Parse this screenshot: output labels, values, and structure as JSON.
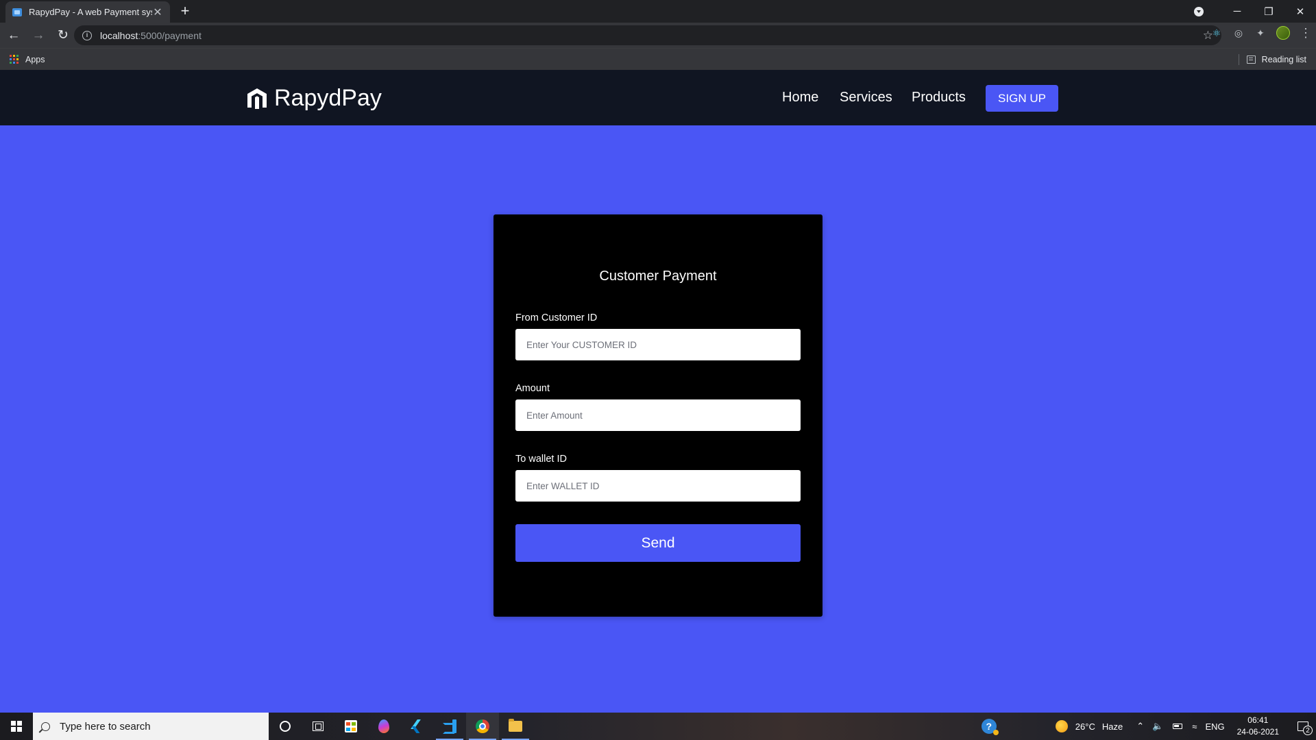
{
  "browser": {
    "tab_title": "RapydPay - A web Payment syste",
    "tab_close": "✕",
    "new_tab": "+",
    "url_host": "localhost",
    "url_path": ":5000/payment",
    "bookmarks": {
      "apps_label": "Apps",
      "reading_list_label": "Reading list"
    },
    "window_controls": {
      "minimize": "─",
      "restore": "❐",
      "close": "✕"
    }
  },
  "site": {
    "brand_name": "RapydPay",
    "nav": {
      "home": "Home",
      "services": "Services",
      "products": "Products",
      "signup": "SIGN UP"
    }
  },
  "payment_form": {
    "title": "Customer Payment",
    "from_label": "From Customer ID",
    "from_placeholder": "Enter Your CUSTOMER ID",
    "amount_label": "Amount",
    "amount_placeholder": "Enter Amount",
    "wallet_label": "To wallet ID",
    "wallet_placeholder": "Enter WALLET ID",
    "send_label": "Send"
  },
  "taskbar": {
    "search_placeholder": "Type here to search",
    "weather_temp": "26°C",
    "weather_desc": "Haze",
    "language": "ENG",
    "time": "06:41",
    "date": "24-06-2021",
    "notification_count": "2"
  },
  "colors": {
    "page_background": "#4a56f5",
    "navbar_background": "#101522",
    "card_background": "#000000",
    "accent": "#4a56f5"
  },
  "icons": {
    "brand_logo": "rapydpay-logo-icon",
    "search": "search-icon",
    "help": "help-icon",
    "weather": "sun-icon"
  }
}
